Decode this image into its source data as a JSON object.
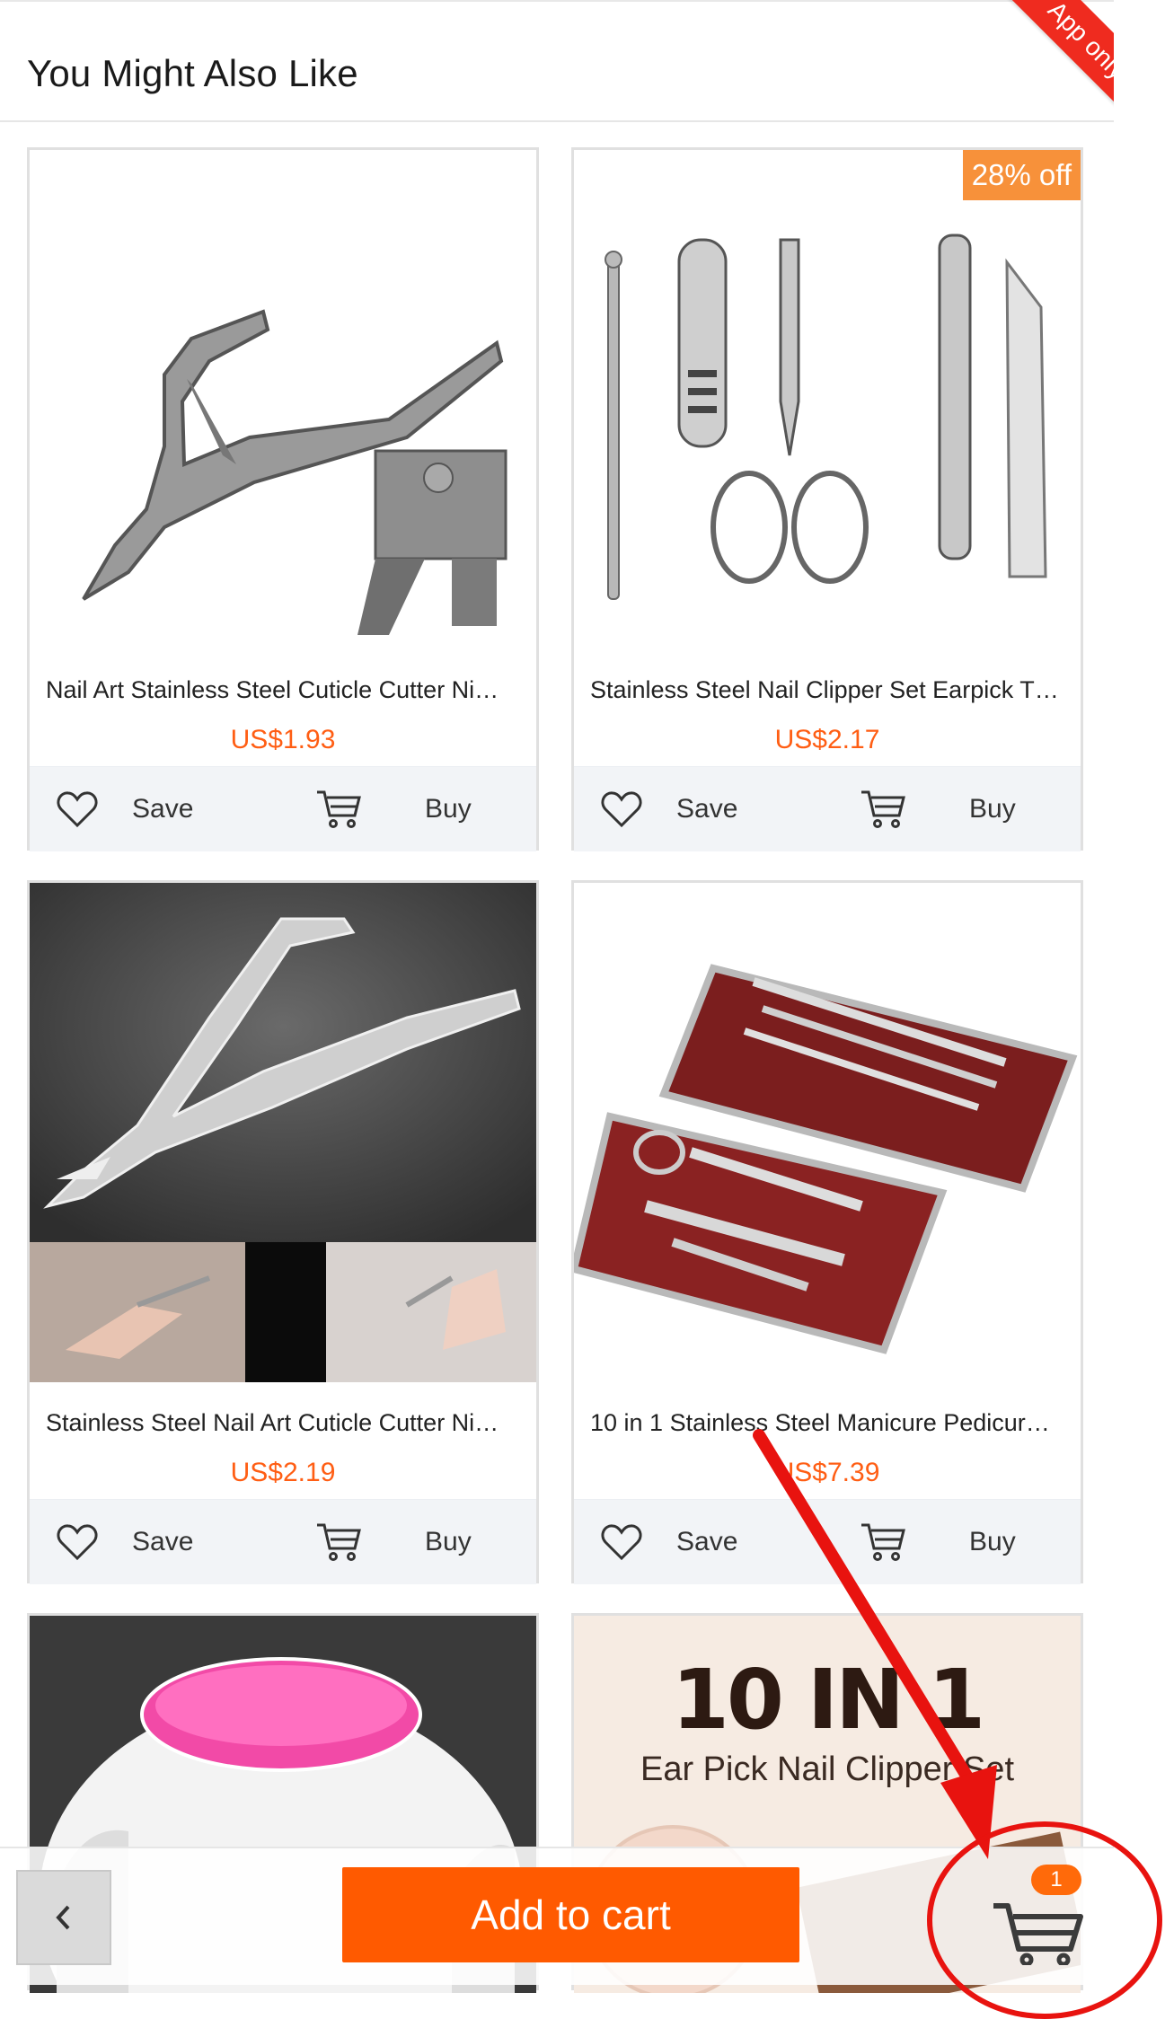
{
  "header": {
    "title": "You Might Also Like",
    "ribbon": "App only"
  },
  "products": [
    {
      "title": "Nail Art Stainless Steel Cuticle Cutter Ni…",
      "price": "US$1.93",
      "save_label": "Save",
      "buy_label": "Buy",
      "discount": ""
    },
    {
      "title": "Stainless Steel Nail Clipper Set Earpick T…",
      "price": "US$2.17",
      "save_label": "Save",
      "buy_label": "Buy",
      "discount": "28% off"
    },
    {
      "title": "Stainless Steel Nail Art Cuticle Cutter Ni…",
      "price": "US$2.19",
      "save_label": "Save",
      "buy_label": "Buy",
      "discount": ""
    },
    {
      "title": "10 in 1 Stainless Steel Manicure Pedicur…",
      "price": "US$7.39",
      "save_label": "Save",
      "buy_label": "Buy",
      "discount": ""
    }
  ],
  "partial_products": [
    {
      "image_text_1": "",
      "image_text_2": ""
    },
    {
      "image_text_1": "10 IN 1",
      "image_text_2": "Ear Pick Nail Clipper Set"
    }
  ],
  "bottom_bar": {
    "add_to_cart_label": "Add to cart",
    "cart_count": "1"
  },
  "colors": {
    "accent": "#ff5a00",
    "price": "#ff5e14",
    "ribbon": "#ef2b1f",
    "discount": "#f7913a",
    "annotation": "#e8130f"
  }
}
